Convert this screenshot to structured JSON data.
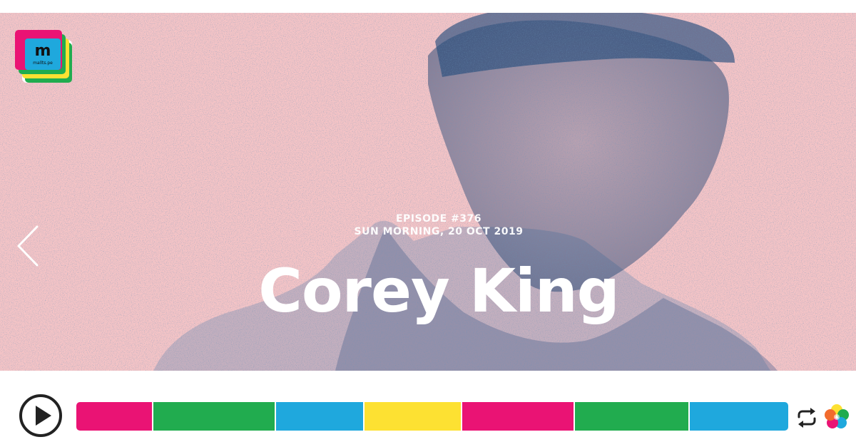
{
  "hero": {
    "episode": "EPISODE #376",
    "date": "SUN MORNING, 20 OCT 2019",
    "title": "Corey King",
    "background_color": "#f5c4c6",
    "ink_color": "#244a7a"
  },
  "logo": {
    "letter": "m",
    "caption": "mallts.pe"
  },
  "navigation": {
    "prev_icon": "chevron-left-icon"
  },
  "player": {
    "play_icon": "play-icon",
    "repeat_icon": "repeat-icon",
    "brand_icon": "petal-logo-icon",
    "segments": [
      {
        "color": "#ea1374",
        "share": 106
      },
      {
        "color": "#21ac4f",
        "share": 171
      },
      {
        "color": "#1fa8dd",
        "share": 123
      },
      {
        "color": "#fde132",
        "share": 135
      },
      {
        "color": "#ea1374",
        "share": 157
      },
      {
        "color": "#21ac4f",
        "share": 159
      },
      {
        "color": "#1fa8dd",
        "share": 139
      }
    ]
  }
}
